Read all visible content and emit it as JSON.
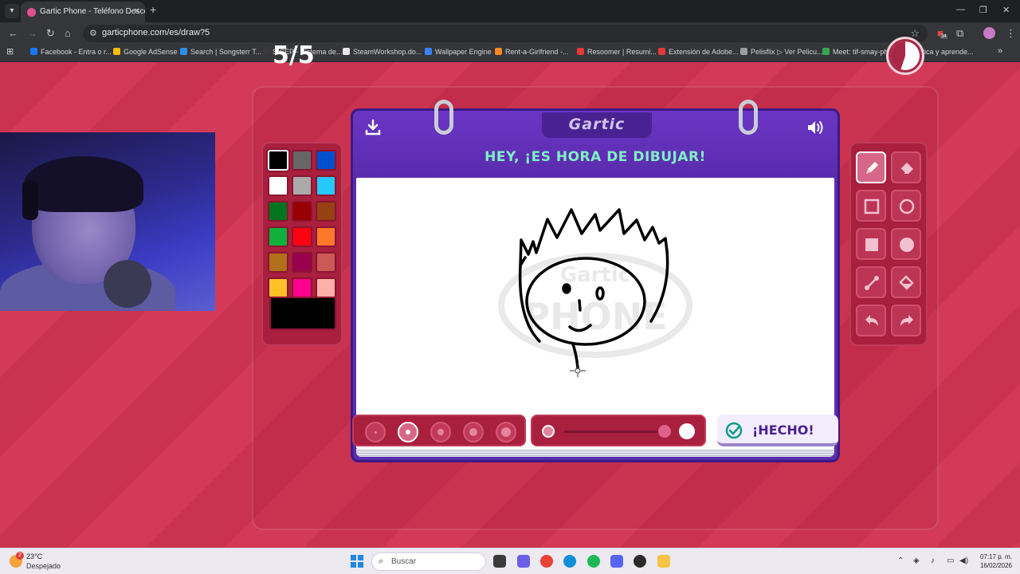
{
  "browser": {
    "tab_title": "Gartic Phone - Teléfono Descom",
    "url": "garticphone.com/es/draw?5",
    "bookmarks": [
      {
        "label": "Facebook - Entra o r...",
        "color": "#1877f2"
      },
      {
        "label": "Google AdSense",
        "color": "#fbbc04"
      },
      {
        "label": "Search | Songsterr T...",
        "color": "#2d8fe3"
      },
      {
        "label": "SICEP - Sistema de...",
        "color": "#3a3a3a"
      },
      {
        "label": "SteamWorkshop.do...",
        "color": "#e8e8e8"
      },
      {
        "label": "Wallpaper Engine",
        "color": "#3b82f6"
      },
      {
        "label": "Rent-a-Girlfriend -...",
        "color": "#f08a24"
      },
      {
        "label": "Resoomer | Resumi...",
        "color": "#e53935"
      },
      {
        "label": "Extensión de Adobe...",
        "color": "#e53935"
      },
      {
        "label": "Pelisflix ▷ Ver Pelicu...",
        "color": "#9e9e9e"
      },
      {
        "label": "Meet: tif-smay-phw",
        "color": "#34a853"
      },
      {
        "label": "Practica y aprende...",
        "color": "#4285f4"
      }
    ],
    "extension_badge": "34"
  },
  "game": {
    "round": "5/5",
    "logo": "Gartic",
    "prompt": "HEY, ¡ES HORA DE DIBUJAR!",
    "done_label": "¡HECHO!",
    "timer_remaining_fraction": 0.55,
    "palette": [
      "#000000",
      "#666666",
      "#0050cd",
      "#ffffff",
      "#aaaaaa",
      "#26c9ff",
      "#017420",
      "#990000",
      "#964112",
      "#11b03c",
      "#ff0013",
      "#ff7829",
      "#b0701c",
      "#99004e",
      "#cb5a57",
      "#ffc126",
      "#ff008f",
      "#feafa8"
    ],
    "selected_color": "#000000",
    "tools": [
      "pencil-icon",
      "eraser-icon",
      "square-outline-icon",
      "circle-outline-icon",
      "square-filled-icon",
      "circle-filled-icon",
      "line-icon",
      "bucket-icon",
      "undo-icon",
      "redo-icon"
    ],
    "active_tool": "pencil-icon",
    "brush_sizes": 5,
    "active_brush_size": 2,
    "colors": {
      "accent": "#5b2cae",
      "prompt": "#7ef2c4",
      "background": "#c93350"
    }
  },
  "taskbar": {
    "weather_temp": "23°C",
    "weather_desc": "Despejado",
    "weather_badge": "2",
    "search_placeholder": "Buscar",
    "time": "07:17 p. m.",
    "date": "16/02/2026"
  }
}
